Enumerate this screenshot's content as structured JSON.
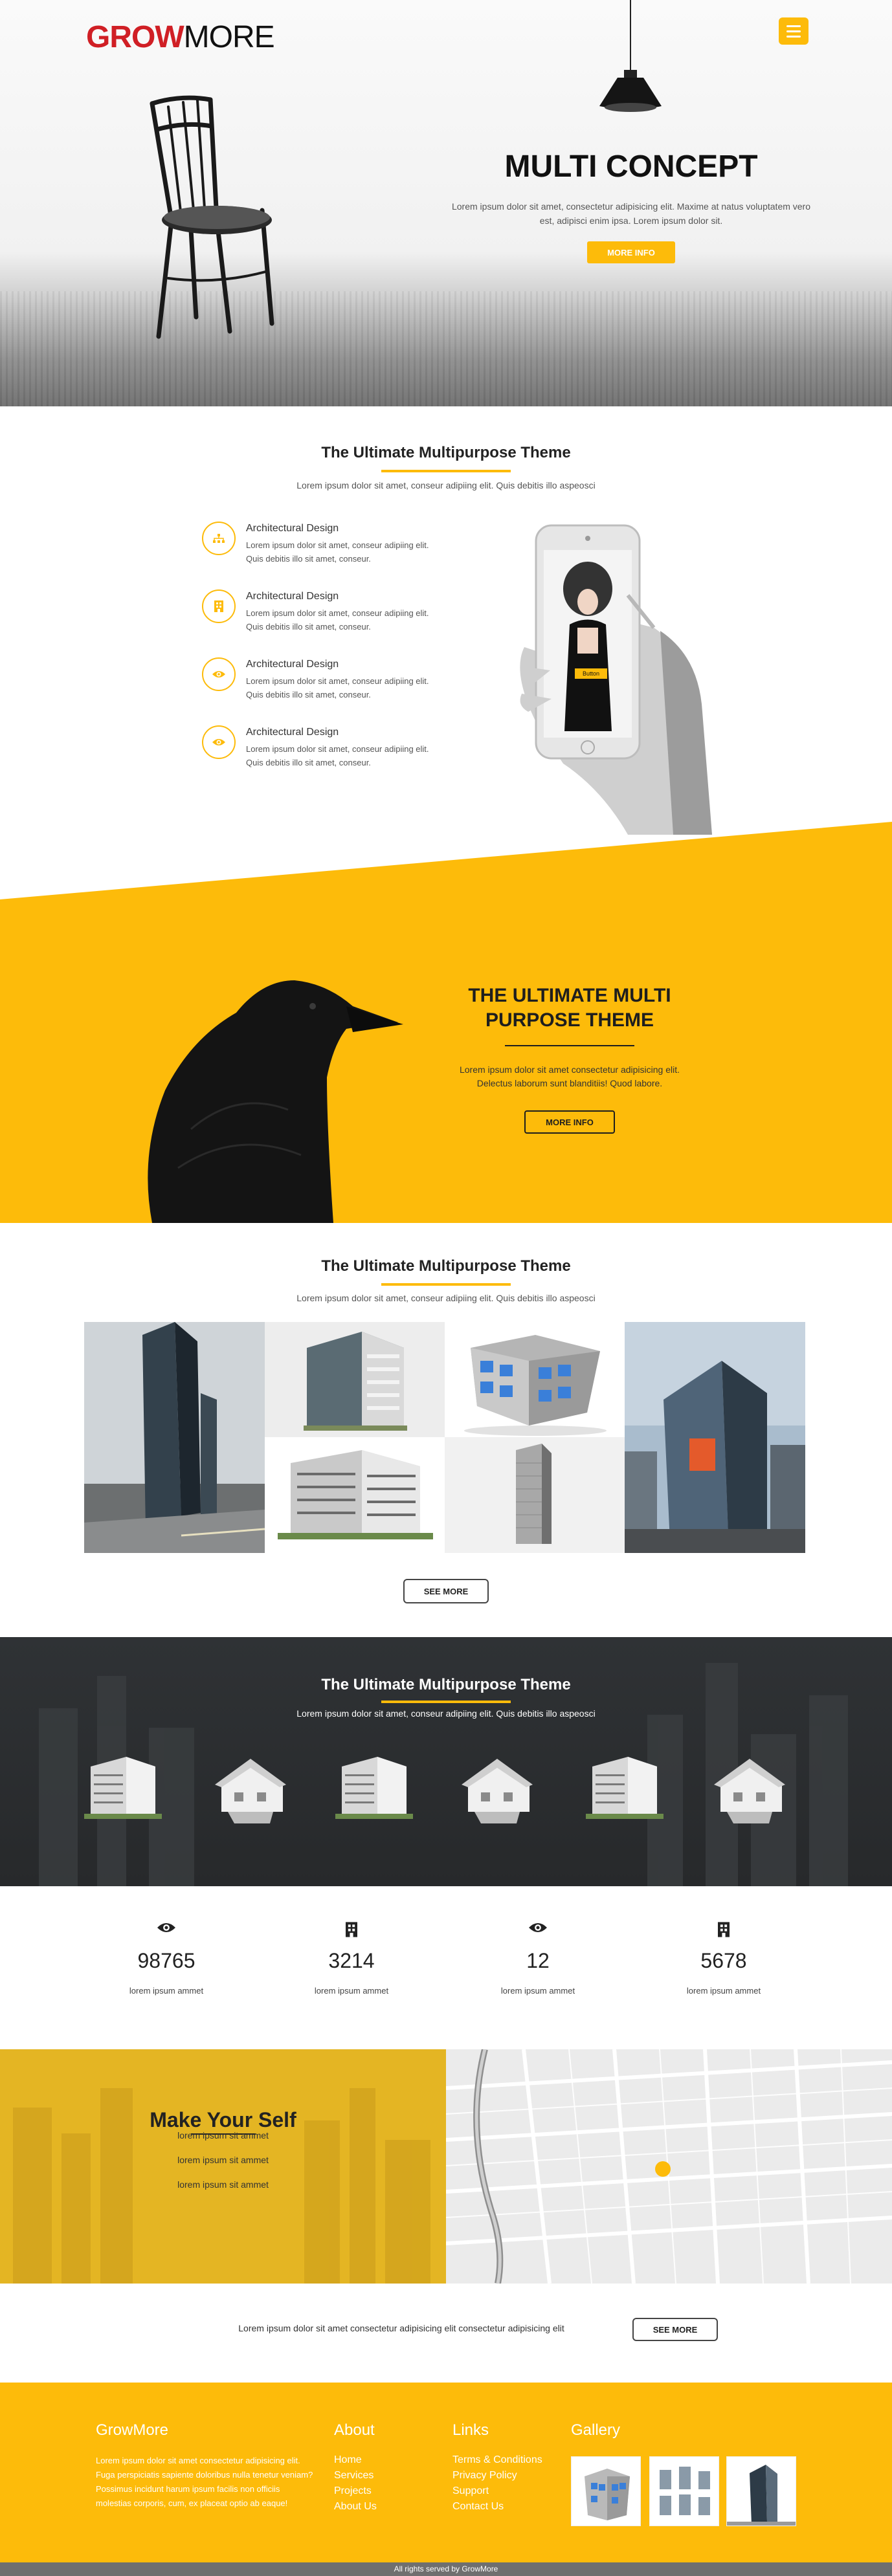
{
  "brand": {
    "grow": "GROW",
    "more": "MORE"
  },
  "hero": {
    "title": "MULTI CONCEPT",
    "text": "Lorem ipsum dolor sit amet, consectetur adipisicing elit. Maxime at natus voluptatem vero est, adipisci enim ipsa. Lorem ipsum dolor sit.",
    "button": "MORE INFO"
  },
  "features_section": {
    "title": "The Ultimate Multipurpose Theme",
    "subtitle": "Lorem ipsum dolor sit amet, conseur adipiing elit. Quis debitis illo aspeosci",
    "items": [
      {
        "title": "Architectural Design",
        "desc": "Lorem ipsum dolor sit amet, conseur adipiing elit. Quis debitis illo sit amet, conseur.",
        "icon": "sitemap-icon"
      },
      {
        "title": "Architectural Design",
        "desc": "Lorem ipsum dolor sit amet, conseur adipiing elit. Quis debitis illo sit amet, conseur.",
        "icon": "building-icon"
      },
      {
        "title": "Architectural Design",
        "desc": "Lorem ipsum dolor sit amet, conseur adipiing elit. Quis debitis illo sit amet, conseur.",
        "icon": "eye-icon"
      },
      {
        "title": "Architectural Design",
        "desc": "Lorem ipsum dolor sit amet, conseur adipiing elit. Quis debitis illo sit amet, conseur.",
        "icon": "eye-icon"
      }
    ],
    "phone_button": "Button"
  },
  "yellow_section": {
    "title": "THE ULTIMATE MULTI PURPOSE THEME",
    "text": "Lorem ipsum dolor sit amet consectetur adipisicing elit. Delectus laborum sunt blanditiis! Quod labore.",
    "button": "MORE INFO"
  },
  "gallery_section": {
    "title": "The Ultimate Multipurpose Theme",
    "subtitle": "Lorem ipsum dolor sit amet, conseur adipiing elit. Quis debitis illo aspeosci",
    "button": "SEE MORE"
  },
  "dark_section": {
    "title": "The Ultimate Multipurpose Theme",
    "subtitle": "Lorem ipsum dolor sit amet, conseur adipiing elit. Quis debitis illo aspeosci"
  },
  "stats": [
    {
      "icon": "eye-icon",
      "number": "98765",
      "label": "lorem ipsum ammet"
    },
    {
      "icon": "building-icon",
      "number": "3214",
      "label": "lorem ipsum ammet"
    },
    {
      "icon": "eye-icon",
      "number": "12",
      "label": "lorem ipsum ammet"
    },
    {
      "icon": "building-icon",
      "number": "5678",
      "label": "lorem ipsum ammet"
    }
  ],
  "make_yourself": {
    "title": "Make Your Self",
    "items": [
      "lorem ipsum sit ammet",
      "lorem ipsum sit ammet",
      "lorem ipsum sit ammet"
    ]
  },
  "cta": {
    "text": "Lorem ipsum dolor sit amet consectetur adipisicing elit consectetur adipisicing elit",
    "button": "SEE MORE"
  },
  "footer": {
    "brand_title": "GrowMore",
    "brand_desc": "Lorem ipsum dolor sit amet consectetur adipisicing elit. Fuga perspiciatis sapiente doloribus nulla tenetur veniam? Possimus incidunt harum ipsum facilis non officiis molestias corporis, cum, ex placeat optio ab eaque!",
    "about_title": "About",
    "about_links": [
      "Home",
      "Services",
      "Projects",
      "About Us"
    ],
    "links_title": "Links",
    "links": [
      "Terms & Conditions",
      "Privacy Policy",
      "Support",
      "Contact Us"
    ],
    "gallery_title": "Gallery",
    "copyright": "All rights served by GrowMore"
  },
  "colors": {
    "accent": "#fdbb0a",
    "brand_red": "#d01f25",
    "dark": "#2b2d2f"
  }
}
